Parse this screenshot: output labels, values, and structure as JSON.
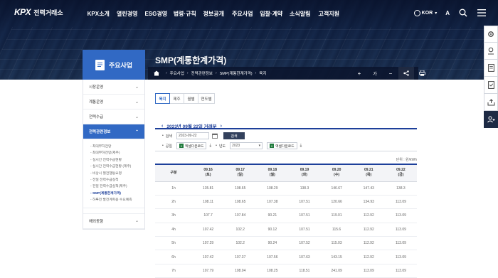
{
  "header": {
    "logo_mark": "KPX",
    "logo_text": "전력거래소",
    "nav": [
      "KPX소개",
      "열린경영",
      "ESG경영",
      "법령·규칙",
      "정보공개",
      "주요사업",
      "입찰·계약",
      "소식알림",
      "고객지원"
    ],
    "lang": "KOR",
    "font_size_label": "A"
  },
  "page": {
    "title": "SMP(계통한계가격)",
    "breadcrumb": [
      "주요사업",
      "전력관련정보",
      "SMP(계통한계가격)",
      "육지"
    ],
    "tools": [
      "+",
      "가",
      "−"
    ]
  },
  "sidebar": {
    "header": "주요사업",
    "items_top": [
      "시장운영",
      "계통운영",
      "전력수급"
    ],
    "active": "전력관련정보",
    "sub_items": [
      "최대부하전망",
      "최대부하전망(제주)",
      "실시간 전력수급현황",
      "실시간 전력수급현황 (제주)",
      "비상시 절전행동요령",
      "전일 전력수급실적",
      "전일 전력수급실적(제주)",
      "SMP(계통한계가격)",
      "하루전 발전계획용 수요예측"
    ],
    "current_sub": "SMP(계통한계가격)",
    "items_bottom": [
      "해외동향"
    ]
  },
  "tabs": [
    "육지",
    "제주",
    "월별",
    "연도별"
  ],
  "active_tab": "육지",
  "date_title": "2023년 09월 22일 거래분",
  "filters": {
    "search_label": "검색",
    "date_value": "2023-09-22",
    "search_button": "검색",
    "notice_label": "공일",
    "excel_label": "엑셀다운로드",
    "year_label": "년도",
    "year_value": "2023",
    "excel_label2": "엑셀다운로드"
  },
  "unit": "단위 : 원/kWh",
  "table": {
    "headers": [
      {
        "line1": "구분",
        "line2": ""
      },
      {
        "line1": "09.16",
        "line2": "(토)"
      },
      {
        "line1": "09.17",
        "line2": "(일)"
      },
      {
        "line1": "09.18",
        "line2": "(월)"
      },
      {
        "line1": "09.19",
        "line2": "(화)"
      },
      {
        "line1": "09.20",
        "line2": "(수)"
      },
      {
        "line1": "09.21",
        "line2": "(목)"
      },
      {
        "line1": "09.22",
        "line2": "(금)"
      }
    ],
    "rows": [
      [
        "1h",
        "135.81",
        "108.65",
        "108.29",
        "138.3",
        "146.67",
        "147.43",
        "138.3"
      ],
      [
        "2h",
        "108.11",
        "108.65",
        "107.38",
        "107.51",
        "120.66",
        "134.93",
        "113.09"
      ],
      [
        "3h",
        "107.7",
        "107.84",
        "90.21",
        "107.51",
        "119.01",
        "112.92",
        "113.09"
      ],
      [
        "4h",
        "107.42",
        "102.2",
        "90.12",
        "107.51",
        "115.6",
        "112.92",
        "113.09"
      ],
      [
        "5h",
        "107.29",
        "102.2",
        "90.24",
        "107.52",
        "115.03",
        "112.92",
        "113.09"
      ],
      [
        "6h",
        "107.42",
        "107.37",
        "107.56",
        "107.63",
        "143.15",
        "112.92",
        "113.09"
      ],
      [
        "7h",
        "107.79",
        "108.04",
        "108.25",
        "118.51",
        "241.09",
        "113.09",
        "113.09"
      ]
    ]
  }
}
